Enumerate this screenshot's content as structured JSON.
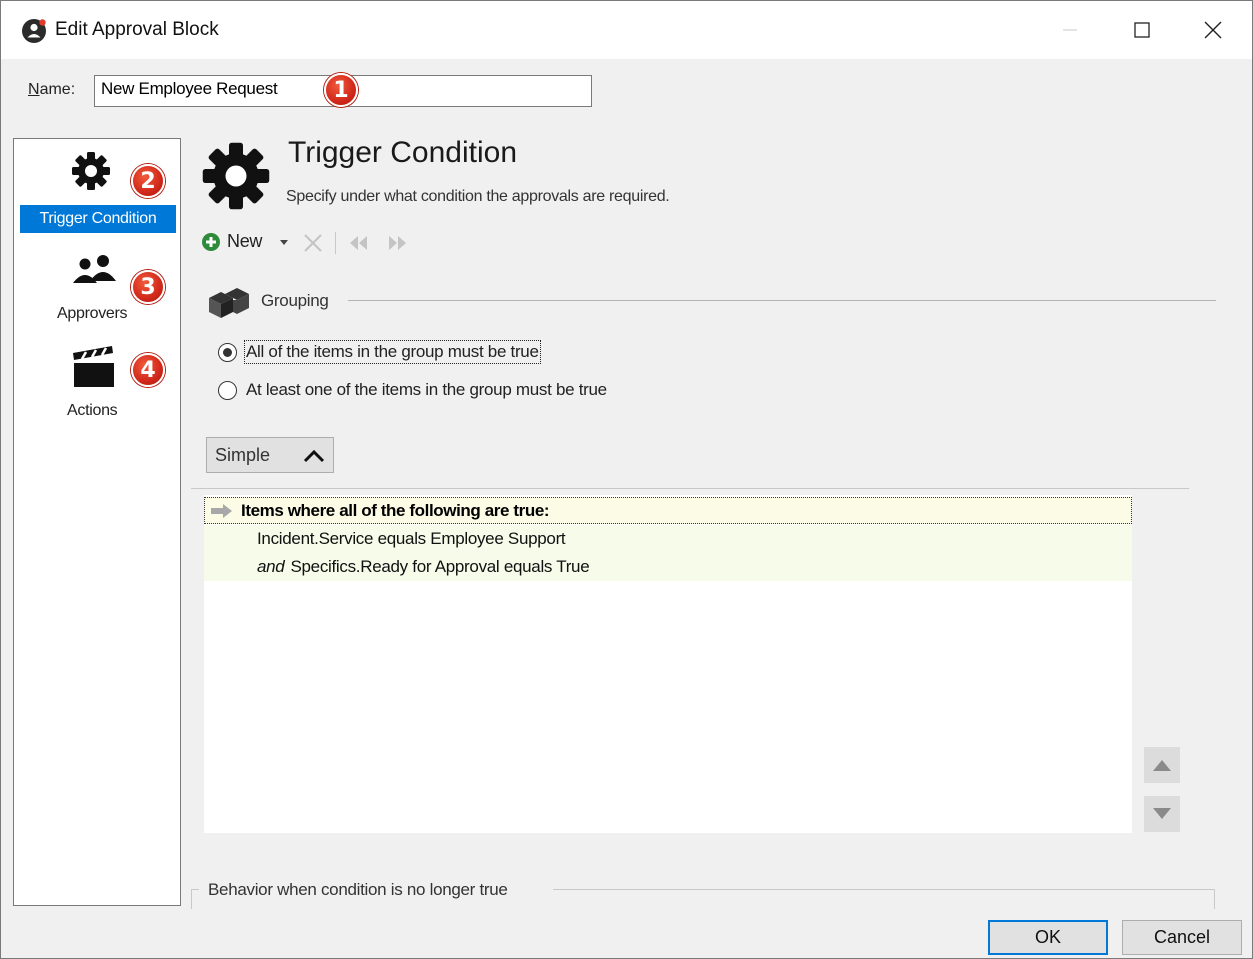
{
  "window": {
    "title": "Edit Approval Block"
  },
  "name_field": {
    "label_accel": "N",
    "label_rest": "ame:",
    "value": "New Employee Request"
  },
  "badges": [
    "1",
    "2",
    "3",
    "4"
  ],
  "nav": {
    "items": [
      {
        "label": "Trigger Condition",
        "icon": "gear-icon",
        "selected": true
      },
      {
        "label": "Approvers",
        "icon": "people-icon",
        "selected": false
      },
      {
        "label": "Actions",
        "icon": "clapperboard-icon",
        "selected": false
      }
    ]
  },
  "header": {
    "title": "Trigger Condition",
    "subtitle": "Specify under what condition the approvals are required."
  },
  "toolbar": {
    "new_label": "New"
  },
  "grouping": {
    "legend": "Grouping",
    "options": [
      {
        "label": "All of the items in the group must be true",
        "selected": true
      },
      {
        "label": "At least one of the items in the group must be true",
        "selected": false
      }
    ]
  },
  "mode_toggle": {
    "label": "Simple"
  },
  "conditions": {
    "header": "Items where all of the following are true:",
    "rows": [
      {
        "conjunction": "",
        "text": "Incident.Service equals Employee Support"
      },
      {
        "conjunction": "and",
        "text": "Specifics.Ready for Approval equals True"
      }
    ]
  },
  "behavior": {
    "legend": "Behavior when condition is no longer true"
  },
  "buttons": {
    "ok": "OK",
    "cancel": "Cancel"
  },
  "colors": {
    "selection": "#0078d7",
    "badge": "#d1281a",
    "condition_bg": "#f7fbea"
  }
}
